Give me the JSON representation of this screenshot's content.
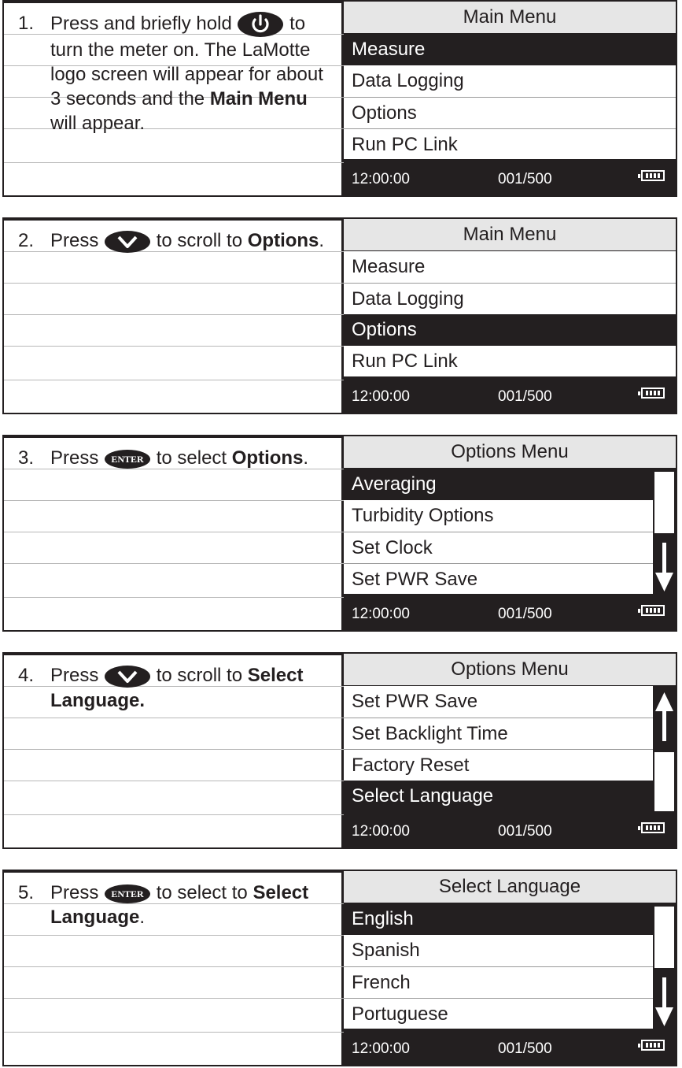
{
  "steps": [
    {
      "num": "1.",
      "before": "Press and briefly hold",
      "after": "to turn the meter on. The LaMotte logo screen will appear for about 3 seconds and the",
      "bold": "Main Menu",
      "tail": "will appear.",
      "icon": "power-button-icon",
      "screen": {
        "title": "Main Menu",
        "items": [
          "Measure",
          "Data Logging",
          "Options",
          "Run PC Link"
        ],
        "selected": 0
      }
    },
    {
      "num": "2.",
      "before": "Press",
      "after": "to scroll to",
      "bold": "Options",
      "tail": ".",
      "icon": "down-arrow-button-icon",
      "screen": {
        "title": "Main Menu",
        "items": [
          "Measure",
          "Data Logging",
          "Options",
          "Run PC Link"
        ],
        "selected": 2
      }
    },
    {
      "num": "3.",
      "before": "Press",
      "after": "to select",
      "bold": "Options",
      "tail": ".",
      "icon": "enter-button-icon",
      "screen": {
        "title": "Options Menu",
        "items": [
          "Averaging",
          "Turbidity Options",
          "Set Clock",
          "Set PWR Save"
        ],
        "selected": 0,
        "scroll": "down"
      }
    },
    {
      "num": "4.",
      "before": "Press",
      "after": "to scroll to",
      "bold": "Select Language.",
      "tail": "",
      "icon": "down-arrow-button-icon",
      "screen": {
        "title": "Options Menu",
        "items": [
          "Set PWR Save",
          "Set Backlight Time",
          "Factory Reset",
          "Select Language"
        ],
        "selected": 3,
        "scroll": "up"
      }
    },
    {
      "num": "5.",
      "before": "Press",
      "after": "to select to",
      "bold": "Select Language",
      "tail": ".",
      "icon": "enter-button-icon",
      "screen": {
        "title": "Select Language",
        "items": [
          "English",
          "Spanish",
          "French",
          "Portuguese"
        ],
        "selected": 0,
        "scroll": "down"
      }
    }
  ],
  "status": {
    "time": "12:00:00",
    "count": "001/500",
    "icon": "battery-icon"
  },
  "icons": {
    "enter_label": "ENTER"
  },
  "colors": {
    "ink": "#231f20",
    "title_bg": "#e6e6e6",
    "rule": "#b8b8b8"
  }
}
